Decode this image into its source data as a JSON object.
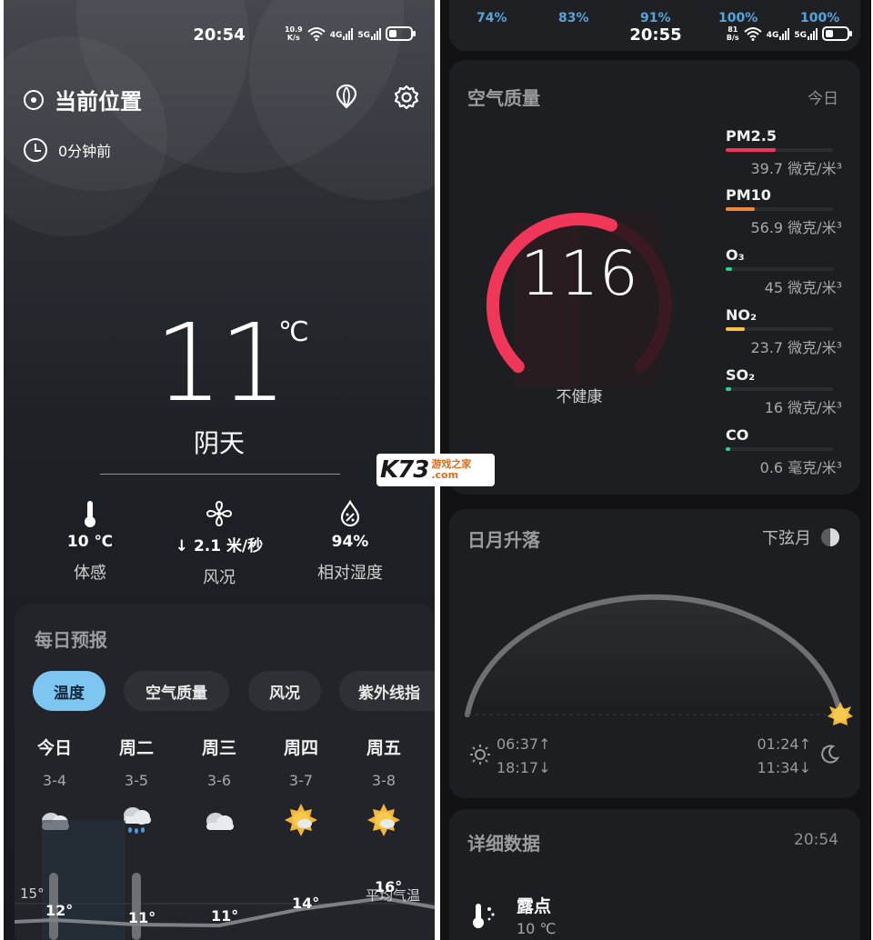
{
  "left": {
    "status": {
      "time": "20:54",
      "net_speed_value": "10.9",
      "net_speed_unit": "K/s",
      "sig1": "4G",
      "sig2": "5G"
    },
    "location": "当前位置",
    "updated": "0分钟前",
    "temperature": "11",
    "temp_unit": "℃",
    "condition": "阴天",
    "metrics": [
      {
        "value": "10 ℃",
        "label": "体感",
        "icon": "thermometer-icon"
      },
      {
        "value": "↓ 2.1 米/秒",
        "label": "风况",
        "icon": "fan-icon"
      },
      {
        "value": "94%",
        "label": "相对湿度",
        "icon": "humidity-icon"
      }
    ],
    "daily": {
      "title": "每日预报",
      "tabs": [
        "温度",
        "空气质量",
        "风况",
        "紫外线指"
      ],
      "days": [
        {
          "name": "今日",
          "date": "3-4",
          "icon": "cloudy-icon"
        },
        {
          "name": "周二",
          "date": "3-5",
          "icon": "rain-icon"
        },
        {
          "name": "周三",
          "date": "3-6",
          "icon": "cloudy-icon"
        },
        {
          "name": "周四",
          "date": "3-7",
          "icon": "partly-sunny-icon"
        },
        {
          "name": "周五",
          "date": "3-8",
          "icon": "partly-sunny-icon"
        }
      ],
      "avg_label": "平均气温",
      "axis_label": "15°",
      "low_values": [
        "12°",
        "11°",
        "11°",
        "14°",
        "16°"
      ]
    }
  },
  "right": {
    "status": {
      "time": "20:55",
      "net_speed_value": "81",
      "net_speed_unit": "B/s",
      "sig1": "4G",
      "sig2": "5G"
    },
    "top_percents": [
      "74%",
      "83%",
      "91%",
      "100%",
      "100%"
    ],
    "air": {
      "title": "空气质量",
      "tag": "今日",
      "aqi": "116",
      "aqi_fraction": 0.58,
      "aqi_desc": "不健康",
      "pollutants": [
        {
          "name": "PM2.5",
          "value": "39.7 微克/米³",
          "fill": 0.47,
          "color": "#f0375a"
        },
        {
          "name": "PM10",
          "value": "56.9 微克/米³",
          "fill": 0.27,
          "color": "#f08a3a"
        },
        {
          "name": "O₃",
          "value": "45 微克/米³",
          "fill": 0.06,
          "color": "#2bcf8f"
        },
        {
          "name": "NO₂",
          "value": "23.7 微克/米³",
          "fill": 0.18,
          "color": "#f5c542"
        },
        {
          "name": "SO₂",
          "value": "16 微克/米³",
          "fill": 0.05,
          "color": "#2bcf8f"
        },
        {
          "name": "CO",
          "value": "0.6 毫克/米³",
          "fill": 0.04,
          "color": "#2bcf8f"
        }
      ]
    },
    "sun": {
      "title": "日月升落",
      "moon_phase": "下弦月",
      "sunrise": "06:37↑",
      "sunset": "18:17↓",
      "moonrise": "01:24↑",
      "moonset": "11:34↓"
    },
    "detail": {
      "title": "详细数据",
      "time": "20:54",
      "dew_label": "露点",
      "dew_value": "10 ℃"
    }
  },
  "watermark": {
    "brand": "K73",
    "site_cn": "游戏之家",
    "site_en": ".com"
  }
}
